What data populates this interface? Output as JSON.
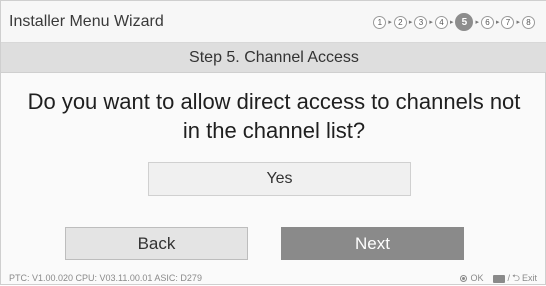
{
  "header": {
    "title": "Installer Menu Wizard",
    "steps": [
      {
        "label": "1",
        "active": false
      },
      {
        "label": "2",
        "active": false
      },
      {
        "label": "3",
        "active": false
      },
      {
        "label": "4",
        "active": false
      },
      {
        "label": "5",
        "active": true
      },
      {
        "label": "6",
        "active": false
      },
      {
        "label": "7",
        "active": false
      },
      {
        "label": "8",
        "active": false
      }
    ],
    "arrow_glyph": "▸"
  },
  "step_title": "Step 5. Channel Access",
  "question": "Do you want to allow direct access to channels not in the channel list?",
  "options": {
    "yes_label": "Yes"
  },
  "buttons": {
    "back_label": "Back",
    "next_label": "Next"
  },
  "footer": {
    "version_text": "PTC:  V1.00.020 CPU: V03.11.00.01 ASIC: D279",
    "ok_label": "OK",
    "exit_label": "Exit",
    "separator": "/"
  },
  "colors": {
    "accent": "#8a8a8a",
    "subtitle_bg": "#dedede"
  }
}
